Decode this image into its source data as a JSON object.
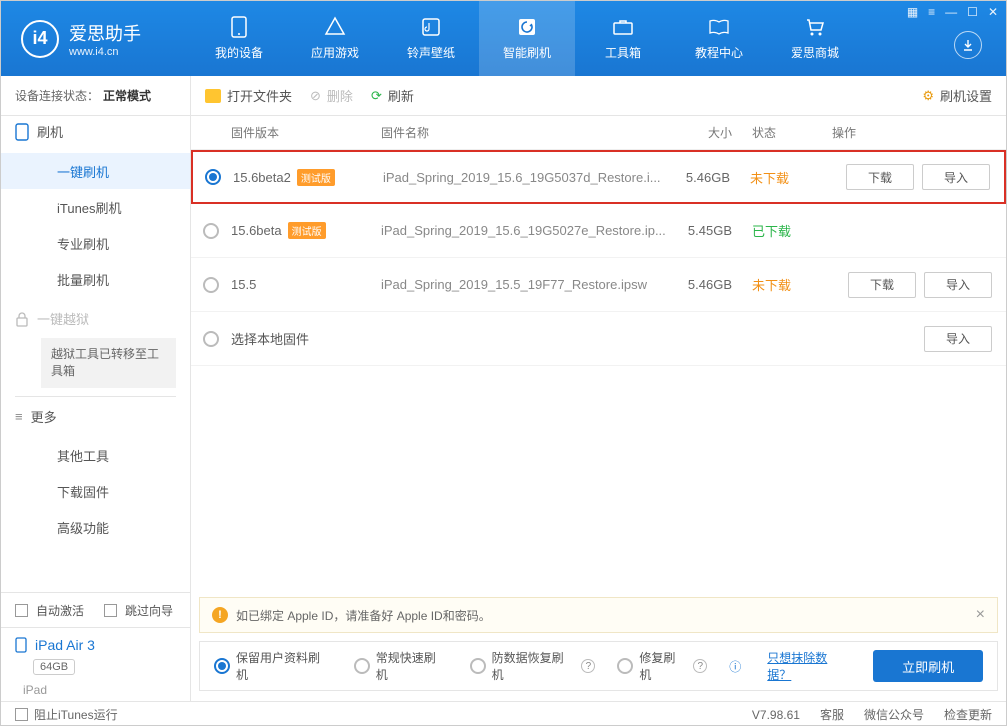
{
  "logo": {
    "title": "爱思助手",
    "url": "www.i4.cn"
  },
  "nav": {
    "items": [
      {
        "label": "我的设备"
      },
      {
        "label": "应用游戏"
      },
      {
        "label": "铃声壁纸"
      },
      {
        "label": "智能刷机"
      },
      {
        "label": "工具箱"
      },
      {
        "label": "教程中心"
      },
      {
        "label": "爱思商城"
      }
    ]
  },
  "connection": {
    "prefix": "设备连接状态：",
    "mode": "正常模式"
  },
  "sidebar": {
    "flash_header": "刷机",
    "items": {
      "one_click": "一键刷机",
      "itunes": "iTunes刷机",
      "pro": "专业刷机",
      "batch": "批量刷机"
    },
    "jailbreak_header": "一键越狱",
    "jailbreak_info": "越狱工具已转移至工具箱",
    "more_header": "更多",
    "more": {
      "other_tools": "其他工具",
      "download_fw": "下载固件",
      "advanced": "高级功能"
    }
  },
  "sidebar_bottom": {
    "auto_activate": "自动激活",
    "skip_guide": "跳过向导",
    "device_name": "iPad Air 3",
    "capacity": "64GB",
    "device_type": "iPad"
  },
  "toolbar": {
    "open_folder": "打开文件夹",
    "delete": "删除",
    "refresh": "刷新",
    "settings": "刷机设置"
  },
  "table": {
    "head": {
      "version": "固件版本",
      "name": "固件名称",
      "size": "大小",
      "status": "状态",
      "ops": "操作"
    },
    "rows": [
      {
        "version": "15.6beta2",
        "beta": "测试版",
        "name": "iPad_Spring_2019_15.6_19G5037d_Restore.i...",
        "size": "5.46GB",
        "status": "未下载",
        "status_class": "not-dl",
        "download": "下载",
        "import": "导入",
        "selected": true,
        "highlight": true,
        "show_ops": true
      },
      {
        "version": "15.6beta",
        "beta": "测试版",
        "name": "iPad_Spring_2019_15.6_19G5027e_Restore.ip...",
        "size": "5.45GB",
        "status": "已下载",
        "status_class": "dl",
        "selected": false,
        "highlight": false,
        "show_ops": false
      },
      {
        "version": "15.5",
        "beta": "",
        "name": "iPad_Spring_2019_15.5_19F77_Restore.ipsw",
        "size": "5.46GB",
        "status": "未下载",
        "status_class": "not-dl",
        "download": "下载",
        "import": "导入",
        "selected": false,
        "highlight": false,
        "show_ops": true
      },
      {
        "version": "",
        "beta": "",
        "name_override": "选择本地固件",
        "size": "",
        "status": "",
        "import": "导入",
        "selected": false,
        "highlight": false,
        "show_import_only": true
      }
    ]
  },
  "warning": {
    "text": "如已绑定 Apple ID，请准备好 Apple ID和密码。"
  },
  "modes": {
    "opts": [
      {
        "label": "保留用户资料刷机",
        "selected": true
      },
      {
        "label": "常规快速刷机",
        "selected": false
      },
      {
        "label": "防数据恢复刷机",
        "selected": false,
        "qmark": true
      },
      {
        "label": "修复刷机",
        "selected": false,
        "qmark": true
      }
    ],
    "erase_link": "只想抹除数据？",
    "flash_btn": "立即刷机"
  },
  "footer": {
    "block_itunes": "阻止iTunes运行",
    "version": "V7.98.61",
    "service": "客服",
    "wechat": "微信公众号",
    "check_update": "检查更新"
  }
}
